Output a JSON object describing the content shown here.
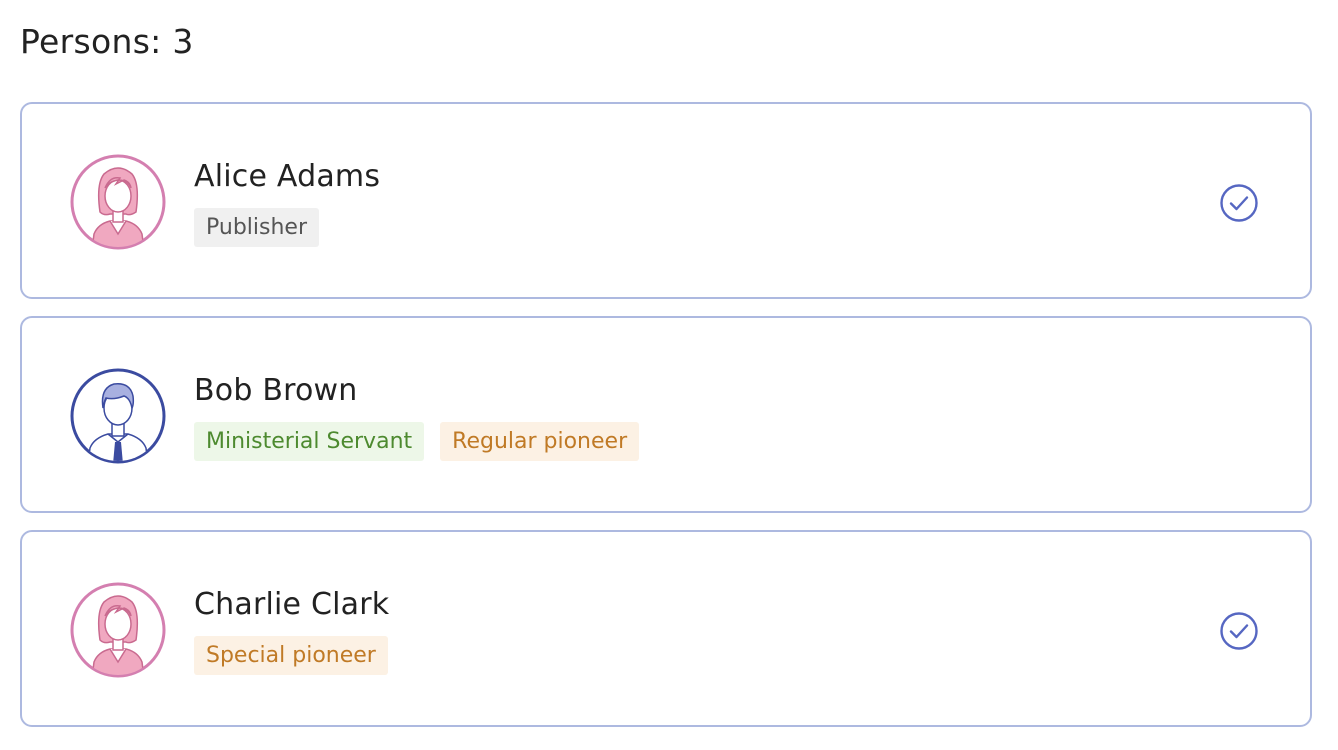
{
  "header": {
    "title": "Persons: 3"
  },
  "persons": [
    {
      "name": "Alice Adams",
      "avatar": "female-avatar-icon",
      "badges": [
        {
          "label": "Publisher",
          "kind": "publisher"
        }
      ],
      "selected": true
    },
    {
      "name": "Bob Brown",
      "avatar": "male-avatar-icon",
      "badges": [
        {
          "label": "Ministerial Servant",
          "kind": "ms"
        },
        {
          "label": "Regular pioneer",
          "kind": "pioneer"
        }
      ],
      "selected": false
    },
    {
      "name": "Charlie Clark",
      "avatar": "female-avatar-icon",
      "badges": [
        {
          "label": "Special pioneer",
          "kind": "pioneer"
        }
      ],
      "selected": true
    }
  ],
  "colors": {
    "card_border": "#adb9e0",
    "female_avatar": "#d47fb0",
    "male_avatar": "#3b4ba0",
    "check": "#5667c2",
    "publisher_bg": "#f0f0f0",
    "ms_text": "#4d8a2f",
    "pioneer_text": "#c07a26"
  }
}
